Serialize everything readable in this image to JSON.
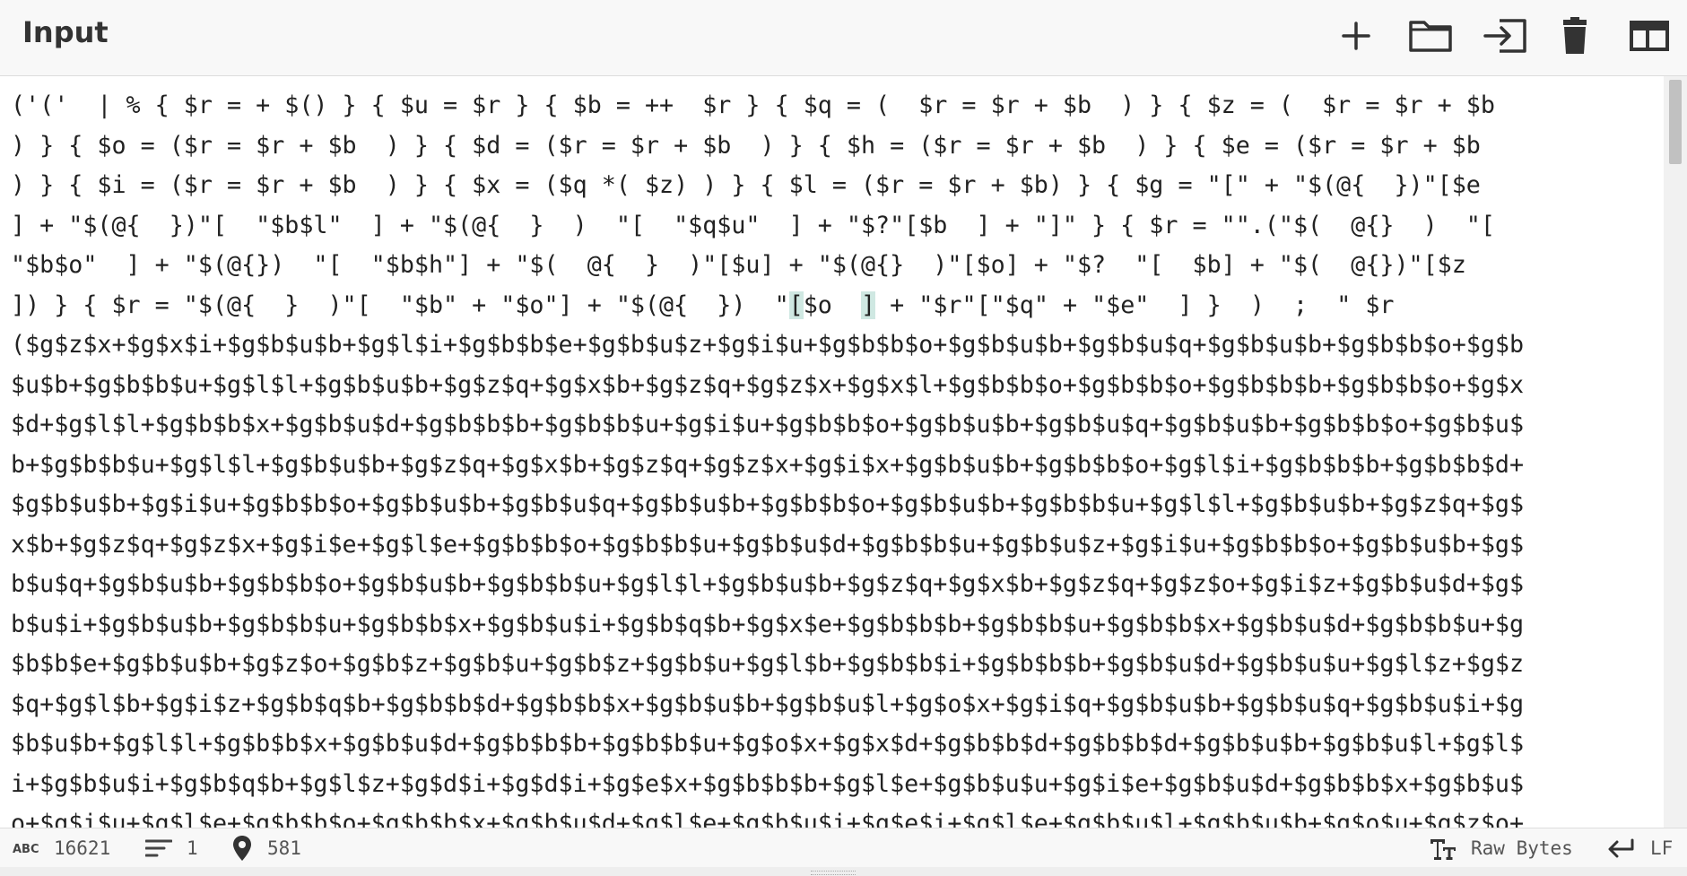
{
  "panel": {
    "title": "Input"
  },
  "toolbar": {
    "buttons": [
      {
        "icon": "plus-icon"
      },
      {
        "icon": "folder-open-icon"
      },
      {
        "icon": "sign-in-icon"
      },
      {
        "icon": "trash-icon"
      },
      {
        "icon": "table-layout-icon"
      }
    ]
  },
  "editor": {
    "lines": [
      "('('  | % { $r = + $() } { $u = $r } { $b = ++  $r } { $q = (  $r = $r + $b  ) } { $z = (  $r = $r + $b",
      ") } { $o = ($r = $r + $b  ) } { $d = ($r = $r + $b  ) } { $h = ($r = $r + $b  ) } { $e = ($r = $r + $b",
      ") } { $i = ($r = $r + $b  ) } { $x = ($q *( $z) ) } { $l = ($r = $r + $b) } { $g = \"[\" + \"$(@{  })\"[$e",
      "] + \"$(@{  })\"[  \"$b$l\"  ] + \"$(@{  }  )  \"[  \"$q$u\"  ] + \"$?\"[$b  ] + \"]\" } { $r = \"\".(\"$(  @{}  )  \"[",
      "\"$b$o\"  ] + \"$(@{})  \"[  \"$b$h\"] + \"$(  @{  }  )\"[$u] + \"$(@{}  )\"[$o] + \"$?  \"[  $b] + \"$(  @{})\"[$z",
      "]) } { $r = \"$(@{  }  )\"[  \"$b\" + \"$o\"] + \"$(@{  })  \"[$o  ] + \"$r\"[\"$q\" + \"$e\"  ] }  )  ;  \" $r",
      "($g$z$x+$g$x$i+$g$b$u$b+$g$l$i+$g$b$b$e+$g$b$u$z+$g$i$u+$g$b$b$o+$g$b$u$b+$g$b$u$q+$g$b$u$b+$g$b$b$o+$g$b",
      "$u$b+$g$b$b$u+$g$l$l+$g$b$u$b+$g$z$q+$g$x$b+$g$z$q+$g$z$x+$g$x$l+$g$b$b$o+$g$b$b$o+$g$b$b$b+$g$b$b$o+$g$x",
      "$d+$g$l$l+$g$b$b$x+$g$b$u$d+$g$b$b$b+$g$b$b$u+$g$i$u+$g$b$b$o+$g$b$u$b+$g$b$u$q+$g$b$u$b+$g$b$b$o+$g$b$u$",
      "b+$g$b$b$u+$g$l$l+$g$b$u$b+$g$z$q+$g$x$b+$g$z$q+$g$z$x+$g$i$x+$g$b$u$b+$g$b$b$o+$g$l$i+$g$b$b$b+$g$b$b$d+",
      "$g$b$u$b+$g$i$u+$g$b$b$o+$g$b$u$b+$g$b$u$q+$g$b$u$b+$g$b$b$o+$g$b$u$b+$g$b$b$u+$g$l$l+$g$b$u$b+$g$z$q+$g$",
      "x$b+$g$z$q+$g$z$x+$g$i$e+$g$l$e+$g$b$b$o+$g$b$b$u+$g$b$u$d+$g$b$b$u+$g$b$u$z+$g$i$u+$g$b$b$o+$g$b$u$b+$g$",
      "b$u$q+$g$b$u$b+$g$b$b$o+$g$b$u$b+$g$b$b$u+$g$l$l+$g$b$u$b+$g$z$q+$g$x$b+$g$z$q+$g$z$o+$g$i$z+$g$b$u$d+$g$",
      "b$u$i+$g$b$u$b+$g$b$b$u+$g$b$b$x+$g$b$u$i+$g$b$q$b+$g$x$e+$g$b$b$b+$g$b$b$u+$g$b$b$x+$g$b$u$d+$g$b$b$u+$g",
      "$b$b$e+$g$b$u$b+$g$z$o+$g$b$z+$g$b$u+$g$b$z+$g$b$u+$g$l$b+$g$b$b$i+$g$b$b$b+$g$b$u$d+$g$b$u$u+$g$l$z+$g$z",
      "$q+$g$l$b+$g$i$z+$g$b$q$b+$g$b$b$d+$g$b$b$x+$g$b$u$b+$g$b$u$l+$g$o$x+$g$i$q+$g$b$u$b+$g$b$u$q+$g$b$u$i+$g",
      "$b$u$b+$g$l$l+$g$b$b$x+$g$b$u$d+$g$b$b$b+$g$b$b$u+$g$o$x+$g$x$d+$g$b$b$d+$g$b$b$d+$g$b$u$b+$g$b$u$l+$g$l$",
      "i+$g$b$u$i+$g$b$q$b+$g$l$z+$g$d$i+$g$d$i+$g$e$x+$g$b$b$b+$g$l$e+$g$b$u$u+$g$i$e+$g$b$u$d+$g$b$b$x+$g$b$u$",
      "o+$g$i$u+$g$l$e+$g$b$b$o+$g$b$b$x+$g$b$u$d+$g$l$e+$g$b$u$i+$g$e$i+$g$l$e+$g$b$u$l+$g$b$u$b+$g$o$u+$g$z$o+"
    ]
  },
  "status": {
    "length": "16621",
    "lines": "1",
    "position": "581",
    "encoding": "Raw Bytes",
    "eol": "LF"
  },
  "colors": {
    "header_bg": "#f8f8f8",
    "text": "#222222",
    "icon": "#333333",
    "bracket_highlight": "#cfe8e2"
  }
}
